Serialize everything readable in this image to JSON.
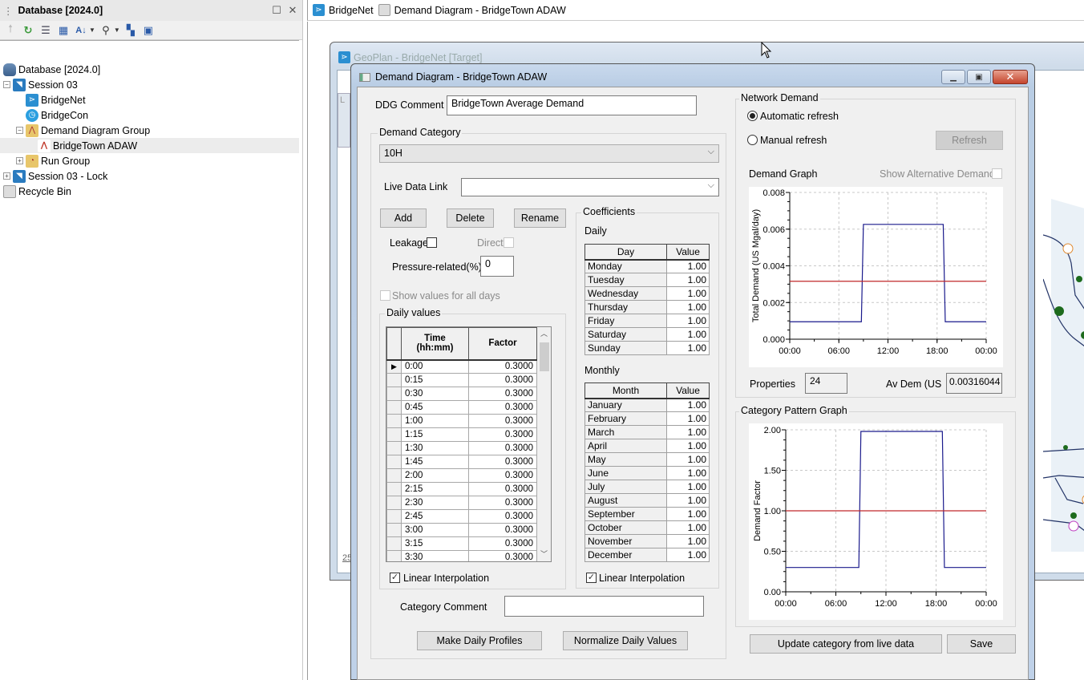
{
  "db_panel": {
    "title": "Database [2024.0]",
    "toolbar_icons": [
      "up-arrow-icon",
      "refresh-icon",
      "properties-icon",
      "grid-icon",
      "sort-icon",
      "find-icon",
      "tree-icon",
      "window-find-icon"
    ],
    "tree": [
      {
        "label": "Database [2024.0]",
        "icon": "database-icon",
        "level": 0,
        "expander": ""
      },
      {
        "label": "Session 03",
        "icon": "session-icon",
        "level": 1,
        "expander": "−"
      },
      {
        "label": "BridgeNet",
        "icon": "network-icon",
        "level": 2,
        "expander": ""
      },
      {
        "label": "BridgeCon",
        "icon": "control-icon",
        "level": 2,
        "expander": ""
      },
      {
        "label": "Demand Diagram Group",
        "icon": "folder-icon",
        "level": 2,
        "expander": "−"
      },
      {
        "label": "BridgeTown ADAW",
        "icon": "demand-diagram-icon",
        "level": 3,
        "expander": "",
        "selected": true
      },
      {
        "label": "Run Group",
        "icon": "run-folder-icon",
        "level": 2,
        "expander": "+"
      },
      {
        "label": "Session 03 - Lock",
        "icon": "session-icon",
        "level": 1,
        "expander": "+"
      },
      {
        "label": "Recycle Bin",
        "icon": "recycle-bin-icon",
        "level": 0,
        "expander": ""
      }
    ]
  },
  "tabs": [
    {
      "label": "BridgeNet",
      "icon": "network-icon"
    },
    {
      "label": "Demand Diagram - BridgeTown ADAW",
      "icon": "demand-diagram-icon"
    }
  ],
  "geoplan": {
    "title": "GeoPlan - BridgeNet [Target]",
    "partial_label_left": "L",
    "scale_text": "25"
  },
  "dialog": {
    "title": "Demand Diagram - BridgeTown ADAW",
    "ddg_comment_label": "DDG Comment",
    "ddg_comment_value": "BridgeTown Average Demand",
    "demand_category_label": "Demand Category",
    "demand_category_value": "10H",
    "live_data_link_label": "Live Data Link",
    "live_data_link_value": "",
    "add_label": "Add",
    "delete_label": "Delete",
    "rename_label": "Rename",
    "leakage_label": "Leakage",
    "leakage_checked": false,
    "direct_label": "Direct",
    "direct_checked": false,
    "pressure_label": "Pressure-related(%)",
    "pressure_value": "0",
    "show_all_days_label": "Show values for all days",
    "daily_values_label": "Daily values",
    "daily_values": {
      "headers": [
        "Time\n(hh:mm)",
        "Factor"
      ],
      "header_time": "Time",
      "header_time_sub": "(hh:mm)",
      "header_factor": "Factor",
      "rows": [
        {
          "time": "0:00",
          "factor": "0.3000"
        },
        {
          "time": "0:15",
          "factor": "0.3000"
        },
        {
          "time": "0:30",
          "factor": "0.3000"
        },
        {
          "time": "0:45",
          "factor": "0.3000"
        },
        {
          "time": "1:00",
          "factor": "0.3000"
        },
        {
          "time": "1:15",
          "factor": "0.3000"
        },
        {
          "time": "1:30",
          "factor": "0.3000"
        },
        {
          "time": "1:45",
          "factor": "0.3000"
        },
        {
          "time": "2:00",
          "factor": "0.3000"
        },
        {
          "time": "2:15",
          "factor": "0.3000"
        },
        {
          "time": "2:30",
          "factor": "0.3000"
        },
        {
          "time": "2:45",
          "factor": "0.3000"
        },
        {
          "time": "3:00",
          "factor": "0.3000"
        },
        {
          "time": "3:15",
          "factor": "0.3000"
        },
        {
          "time": "3:30",
          "factor": "0.3000"
        }
      ]
    },
    "linear_interp_label": "Linear Interpolation",
    "linear_interp_daily_checked": true,
    "coefficients_label": "Coefficients",
    "daily_label": "Daily",
    "daily_coeffs": {
      "header_name": "Day",
      "header_value": "Value",
      "rows": [
        {
          "name": "Monday",
          "value": "1.00"
        },
        {
          "name": "Tuesday",
          "value": "1.00"
        },
        {
          "name": "Wednesday",
          "value": "1.00"
        },
        {
          "name": "Thursday",
          "value": "1.00"
        },
        {
          "name": "Friday",
          "value": "1.00"
        },
        {
          "name": "Saturday",
          "value": "1.00"
        },
        {
          "name": "Sunday",
          "value": "1.00"
        }
      ]
    },
    "monthly_label": "Monthly",
    "monthly_coeffs": {
      "header_name": "Month",
      "header_value": "Value",
      "rows": [
        {
          "name": "January",
          "value": "1.00"
        },
        {
          "name": "February",
          "value": "1.00"
        },
        {
          "name": "March",
          "value": "1.00"
        },
        {
          "name": "April",
          "value": "1.00"
        },
        {
          "name": "May",
          "value": "1.00"
        },
        {
          "name": "June",
          "value": "1.00"
        },
        {
          "name": "July",
          "value": "1.00"
        },
        {
          "name": "August",
          "value": "1.00"
        },
        {
          "name": "September",
          "value": "1.00"
        },
        {
          "name": "October",
          "value": "1.00"
        },
        {
          "name": "November",
          "value": "1.00"
        },
        {
          "name": "December",
          "value": "1.00"
        }
      ]
    },
    "linear_interp_coeff_checked": true,
    "category_comment_label": "Category Comment",
    "category_comment_value": "",
    "make_daily_profiles_label": "Make Daily Profiles",
    "normalize_daily_values_label": "Normalize Daily Values",
    "network_demand_label": "Network Demand",
    "automatic_refresh_label": "Automatic refresh",
    "manual_refresh_label": "Manual refresh",
    "refresh_mode": "automatic",
    "refresh_label": "Refresh",
    "demand_graph_label": "Demand Graph",
    "show_alt_demand_label": "Show Alternative Demand",
    "show_alt_demand_checked": false,
    "properties_label": "Properties",
    "properties_value": "24",
    "av_dem_label": "Av Dem (US",
    "av_dem_value": "0.00316044",
    "category_pattern_label": "Category Pattern Graph",
    "update_from_live_label": "Update category from live data",
    "save_label": "Save"
  },
  "colors": {
    "series": "#1a1a8c",
    "average": "#c0282a",
    "grid": "#c8c8c8"
  },
  "chart_data": [
    {
      "type": "line",
      "title": "Demand Graph",
      "xlabel": "",
      "ylabel": "Total Demand (US Mgal/day)",
      "x_ticks": [
        "00:00",
        "06:00",
        "12:00",
        "18:00",
        "00:00"
      ],
      "x_range_hours": [
        0,
        24
      ],
      "y_ticks": [
        "0.000",
        "0.002",
        "0.004",
        "0.006",
        "0.008"
      ],
      "ylim": [
        0,
        0.008
      ],
      "grid": true,
      "series": [
        {
          "name": "Demand",
          "x": [
            0,
            8.75,
            9.0,
            18.75,
            19.0,
            24
          ],
          "values": [
            0.00095,
            0.00095,
            0.00626,
            0.00626,
            0.00095,
            0.00095
          ]
        },
        {
          "name": "Average",
          "x": [
            0,
            24
          ],
          "values": [
            0.00316,
            0.00316
          ]
        }
      ]
    },
    {
      "type": "line",
      "title": "Category Pattern Graph",
      "xlabel": "",
      "ylabel": "Demand Factor",
      "x_ticks": [
        "00:00",
        "06:00",
        "12:00",
        "18:00",
        "00:00"
      ],
      "x_range_hours": [
        0,
        24
      ],
      "y_ticks": [
        "0.00",
        "0.50",
        "1.00",
        "1.50",
        "2.00"
      ],
      "ylim": [
        0,
        2.0
      ],
      "grid": true,
      "series": [
        {
          "name": "Pattern",
          "x": [
            0,
            8.75,
            9.0,
            18.75,
            19.0,
            24
          ],
          "values": [
            0.3,
            0.3,
            1.98,
            1.98,
            0.3,
            0.3
          ]
        },
        {
          "name": "Average",
          "x": [
            0,
            24
          ],
          "values": [
            1.0,
            1.0
          ]
        }
      ]
    }
  ]
}
